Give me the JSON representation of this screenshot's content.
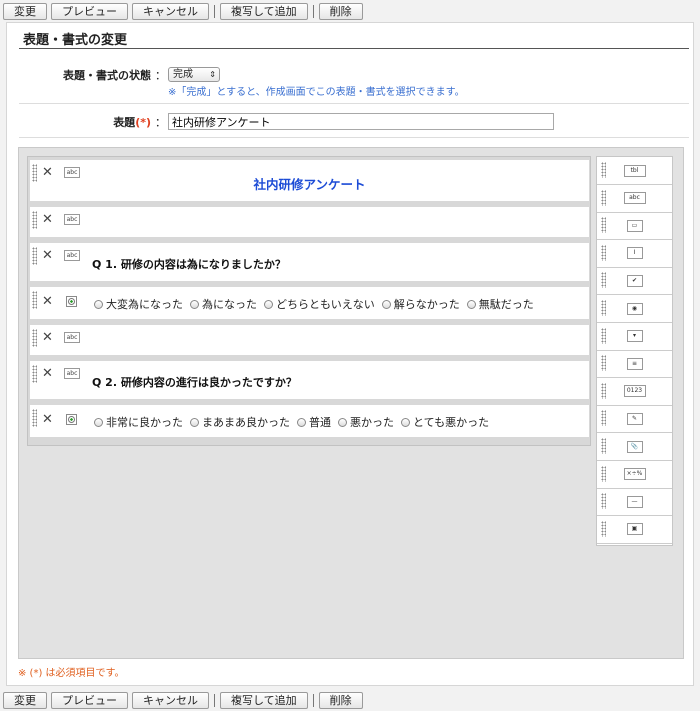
{
  "toolbar": {
    "change": "変更",
    "preview": "プレビュー",
    "cancel": "キャンセル",
    "copy_add": "複写して追加",
    "delete": "削除"
  },
  "page_title": "表題・書式の変更",
  "status": {
    "label": "表題・書式の状態",
    "colon": "：",
    "value": "完成",
    "note": "※「完成」とすると、作成画面でこの表題・書式を選択できます。"
  },
  "subject": {
    "label": "表題",
    "required_mark": "(*)",
    "colon": "：",
    "value": "社内研修アンケート"
  },
  "form": {
    "title": "社内研修アンケート",
    "q1": "Q 1. 研修の内容は為になりましたか？",
    "q1_options": [
      "大変為になった",
      "為になった",
      "どちらともいえない",
      "解らなかった",
      "無駄だった"
    ],
    "q2": "Q 2. 研修内容の進行は良かったですか？",
    "q2_options": [
      "非常に良かった",
      "まあまあ良かった",
      "普通",
      "悪かった",
      "とても悪かった"
    ],
    "text_icon": "abc"
  },
  "palette": [
    {
      "name": "table-tool-icon",
      "glyph": "tbl"
    },
    {
      "name": "text-tool-icon",
      "glyph": "abc"
    },
    {
      "name": "textarea-tool-icon",
      "glyph": "▭"
    },
    {
      "name": "textbox-tool-icon",
      "glyph": "I"
    },
    {
      "name": "checkbox-tool-icon",
      "glyph": "✔"
    },
    {
      "name": "radio-tool-icon",
      "glyph": "◉"
    },
    {
      "name": "select-tool-icon",
      "glyph": "▾"
    },
    {
      "name": "list-tool-icon",
      "glyph": "≡"
    },
    {
      "name": "number-tool-icon",
      "glyph": "0123"
    },
    {
      "name": "memo-tool-icon",
      "glyph": "✎"
    },
    {
      "name": "attachment-tool-icon",
      "glyph": "📎"
    },
    {
      "name": "calc-tool-icon",
      "glyph": "×÷%"
    },
    {
      "name": "line-tool-icon",
      "glyph": "—"
    },
    {
      "name": "image-tool-icon",
      "glyph": "▣"
    }
  ],
  "footnote": "※ (*) は必須項目です。"
}
